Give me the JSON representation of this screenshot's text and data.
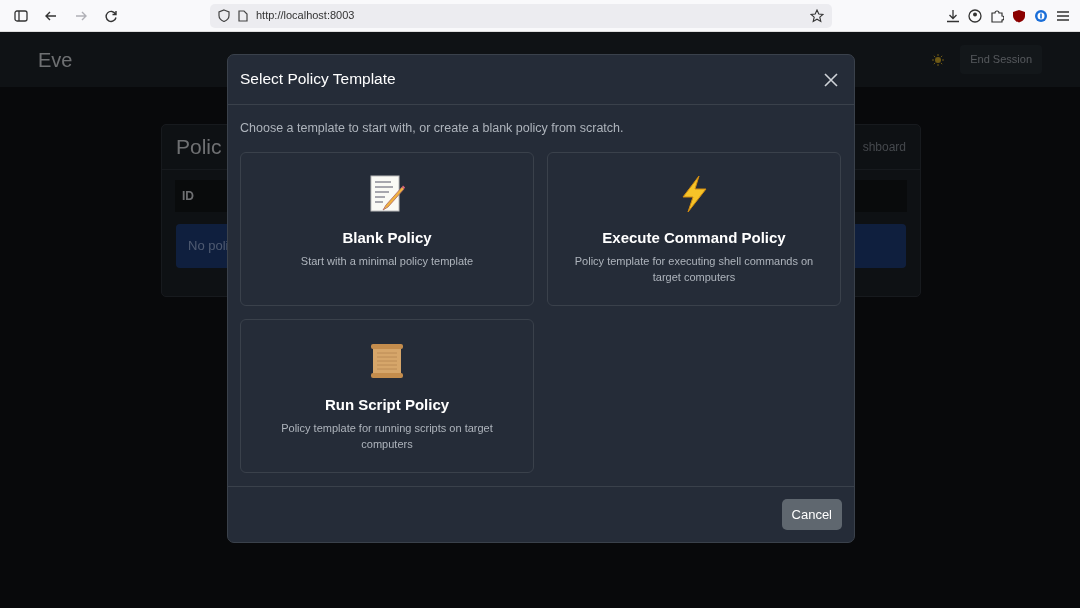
{
  "browser": {
    "nav_buttons": [
      {
        "kind": "back",
        "disabled": false
      },
      {
        "kind": "forward",
        "disabled": true
      },
      {
        "kind": "reload",
        "disabled": false
      }
    ],
    "url": "http://localhost:8003"
  },
  "app": {
    "brand": "Eve",
    "end_session": "End Session",
    "page_title": "Polic",
    "header_link": "shboard",
    "table_header": "ID",
    "empty_message": "No poli"
  },
  "modal": {
    "title": "Select Policy Template",
    "intro": "Choose a template to start with, or create a blank policy from scratch.",
    "templates": [
      {
        "kind": "memo",
        "title": "Blank Policy",
        "description": "Start with a minimal policy template"
      },
      {
        "kind": "lightning",
        "title": "Execute Command Policy",
        "description": "Policy template for executing shell commands on target computers"
      },
      {
        "kind": "scroll",
        "title": "Run Script Policy",
        "description": "Policy template for running scripts on target computers"
      }
    ],
    "cancel": "Cancel"
  }
}
